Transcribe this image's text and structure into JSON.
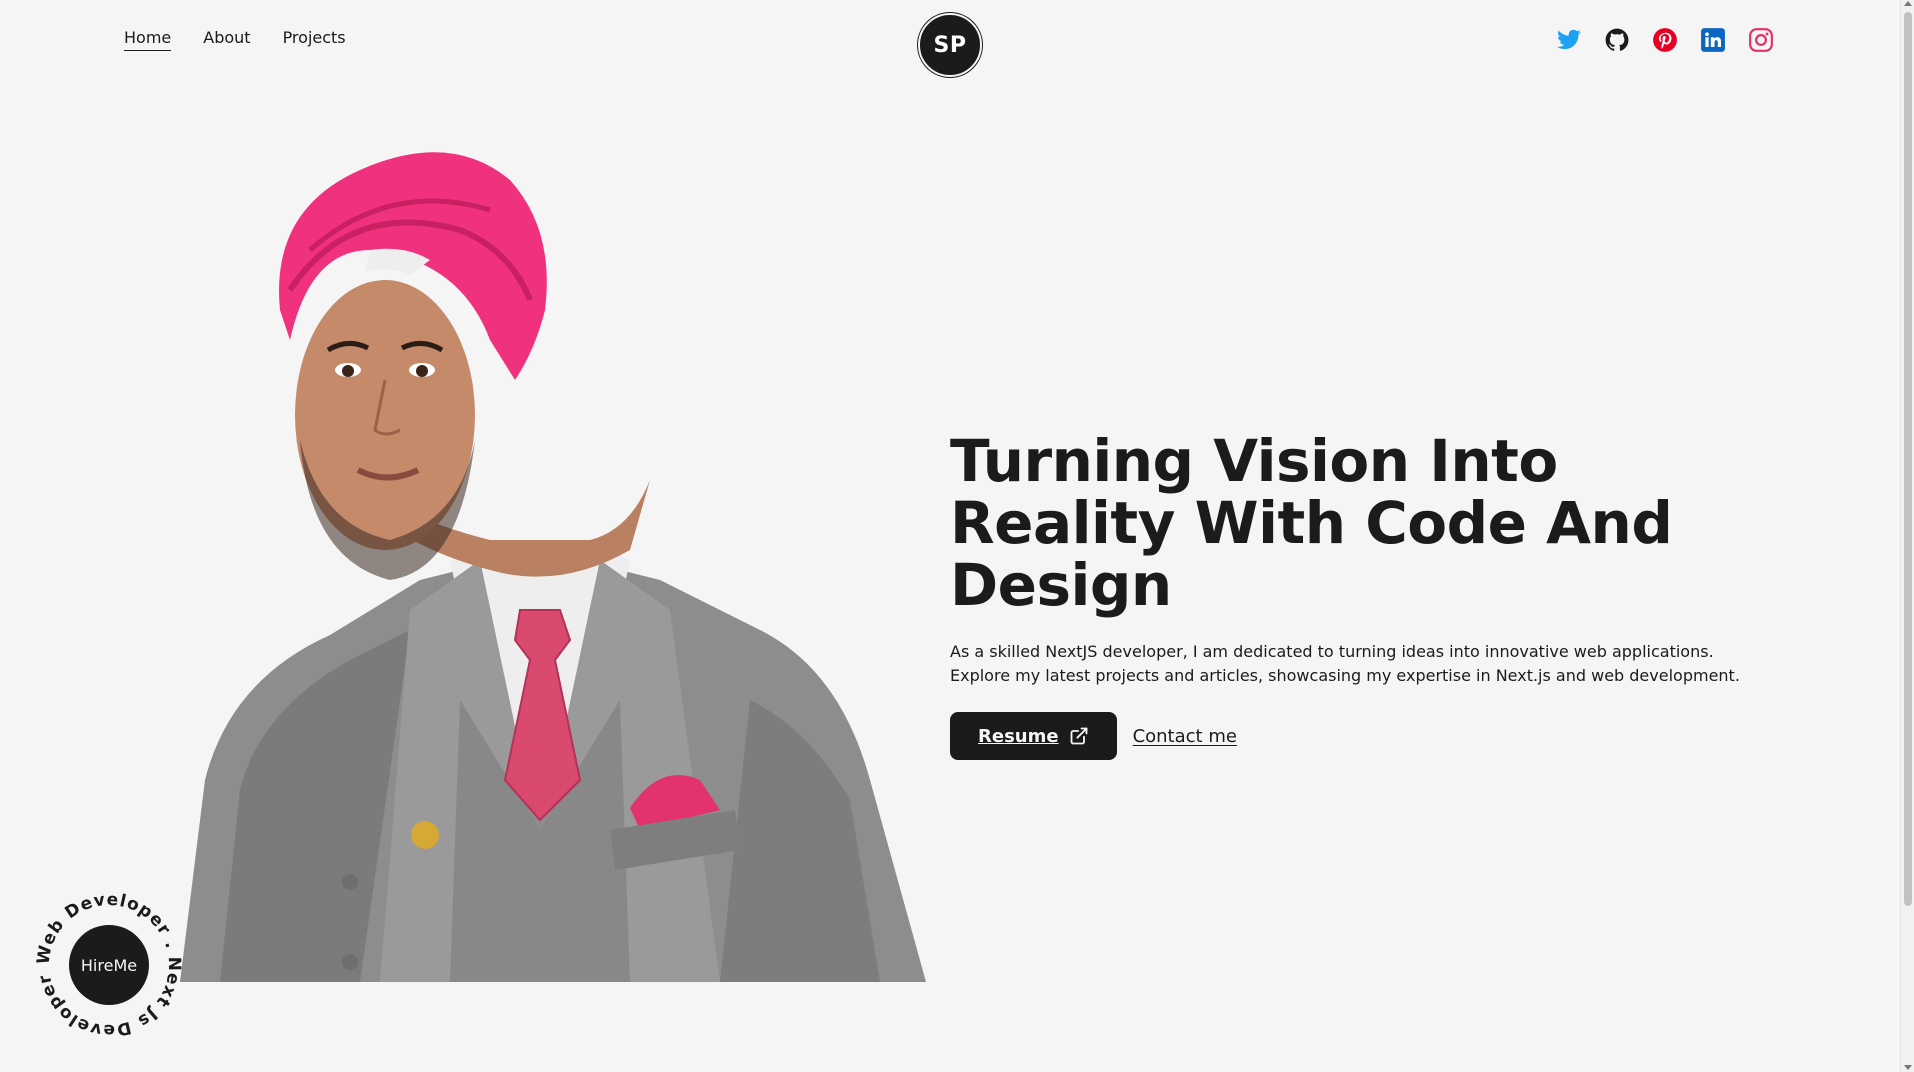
{
  "nav": {
    "items": [
      {
        "label": "Home",
        "active": true
      },
      {
        "label": "About",
        "active": false
      },
      {
        "label": "Projects",
        "active": false
      }
    ]
  },
  "logo": {
    "text": "SP"
  },
  "socials": [
    {
      "name": "twitter-icon",
      "color": "#1DA1F2"
    },
    {
      "name": "github-icon",
      "color": "#1b1b1b"
    },
    {
      "name": "pinterest-icon",
      "color": "#E60023"
    },
    {
      "name": "linkedin-icon",
      "color": "#0A66C2"
    },
    {
      "name": "instagram-icon",
      "color": "#E1306C"
    }
  ],
  "hero": {
    "title": "Turning Vision Into Reality With Code And Design",
    "description": "As a skilled NextJS developer, I am dedicated to turning ideas into innovative web applications. Explore my latest projects and articles, showcasing my expertise in Next.js and web development.",
    "resume_label": "Resume",
    "contact_label": "Contact me"
  },
  "hireme": {
    "label": "HireMe",
    "ring_text": "Web Developer . Next Js Developer . "
  },
  "colors": {
    "dark": "#1b1b1b",
    "light": "#f5f5f5",
    "turban": "#f0327e",
    "suit": "#8a8a8a"
  }
}
